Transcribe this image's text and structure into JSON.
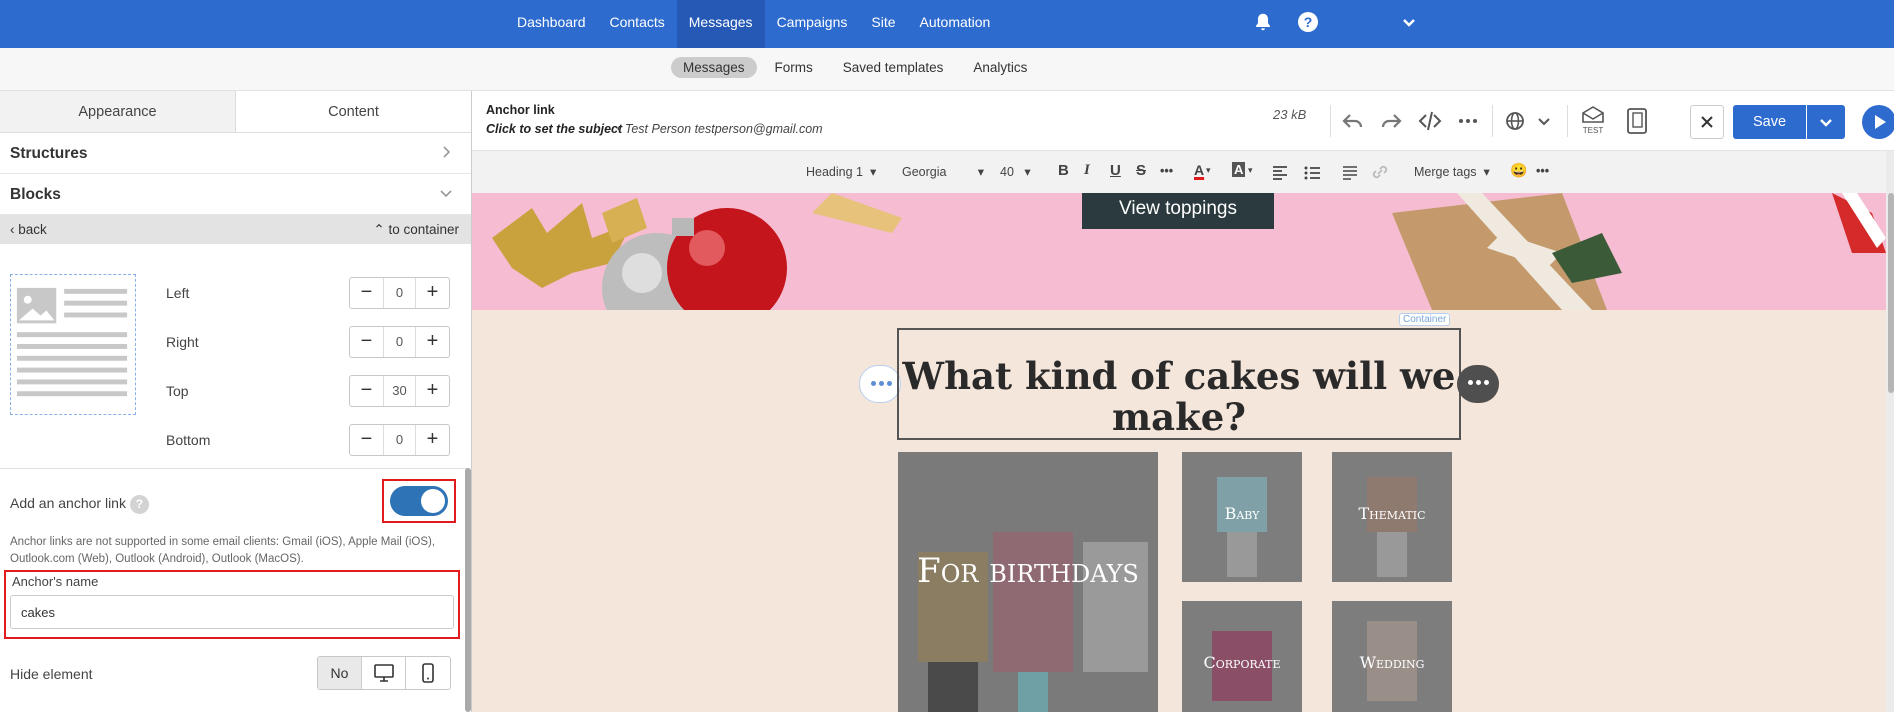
{
  "topnav": {
    "items": [
      "Dashboard",
      "Contacts",
      "Messages",
      "Campaigns",
      "Site",
      "Automation"
    ],
    "active": "Messages",
    "help": "?"
  },
  "subnav": {
    "tabs": [
      "Messages",
      "Forms",
      "Saved templates",
      "Analytics"
    ],
    "active": "Messages"
  },
  "left_panel": {
    "tabs": [
      "Appearance",
      "Content"
    ],
    "active_tab": "Content",
    "structures": "Structures",
    "blocks": "Blocks",
    "back": "back",
    "to_container": "to container",
    "padding": {
      "left": {
        "label": "Left",
        "value": "0"
      },
      "right": {
        "label": "Right",
        "value": "0"
      },
      "top": {
        "label": "Top",
        "value": "30"
      },
      "bottom": {
        "label": "Bottom",
        "value": "0"
      }
    },
    "anchor": {
      "label": "Add an anchor link",
      "help": "?",
      "enabled": true,
      "note": "Anchor links are not supported in some email clients: Gmail (iOS), Apple Mail (iOS), Outlook.com (Web), Outlook (Android), Outlook (MacOS).",
      "name_label": "Anchor's name",
      "name_value": "cakes"
    },
    "hide": {
      "label": "Hide element",
      "no": "No"
    }
  },
  "editor_header": {
    "title": "Anchor link",
    "subject": "Click to set the subject",
    "sender": "• Test Person testperson@gmail.com",
    "size": "23 kB",
    "test_label": "TEST",
    "save": "Save"
  },
  "toolbar": {
    "heading": "Heading 1",
    "font": "Georgia",
    "size": "40",
    "bold": "B",
    "italic": "I",
    "underline": "U",
    "strike": "S",
    "more": "•••",
    "font_color": "A",
    "bg_color": "A",
    "merge_tags": "Merge tags",
    "emoji": "😀"
  },
  "canvas": {
    "button": "View toppings",
    "container_label": "Container",
    "heading": "What kind of cakes will we make?",
    "cards": [
      {
        "label": "For birthdays"
      },
      {
        "label": "Baby"
      },
      {
        "label": "Thematic"
      },
      {
        "label": "Corporate"
      },
      {
        "label": "Wedding"
      }
    ]
  },
  "colors": {
    "brand_blue": "#2d6bcf",
    "highlight_red": "#e01b1b",
    "toggle_blue": "#2d73b5",
    "banner_pink": "#f5bcd2",
    "body_bg": "#f5e6dc"
  }
}
